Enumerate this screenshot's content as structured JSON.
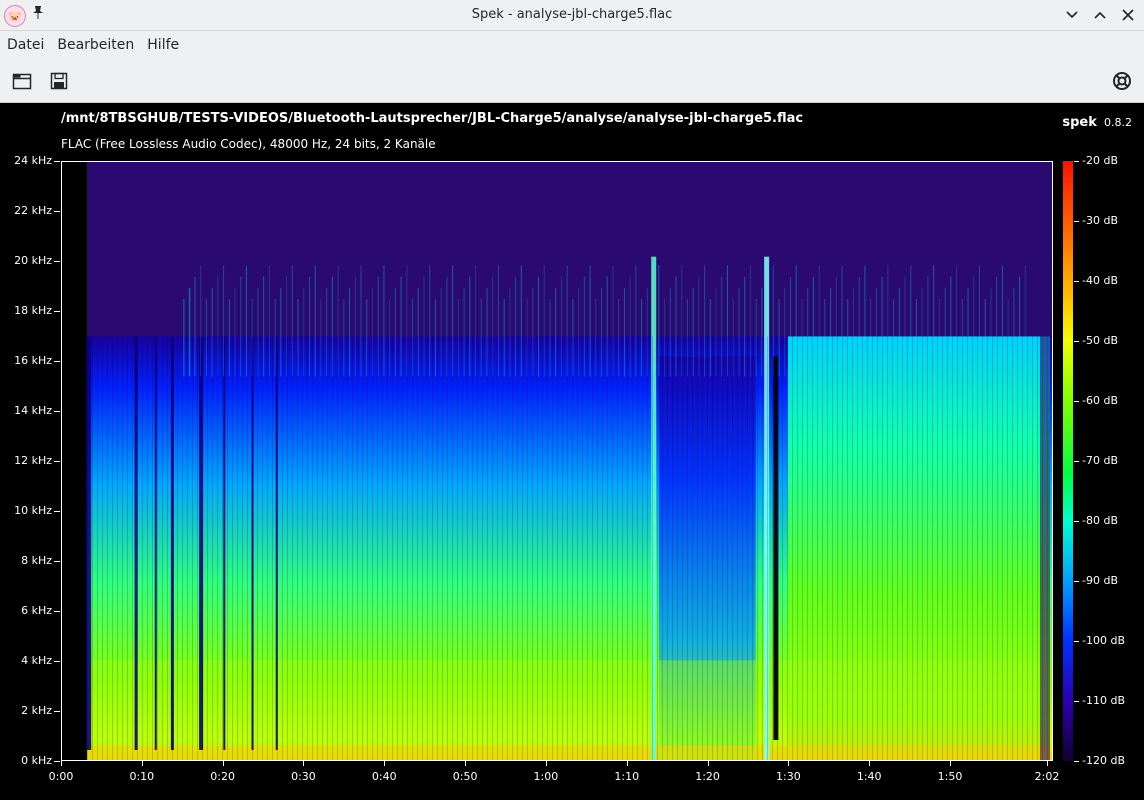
{
  "window": {
    "title": "Spek - analyse-jbl-charge5.flac",
    "controls": [
      "minimize",
      "maximize",
      "close"
    ]
  },
  "menu": {
    "items": [
      "Datei",
      "Bearbeiten",
      "Hilfe"
    ]
  },
  "toolbar": {
    "open_icon": "folder-open-icon",
    "save_icon": "save-icon",
    "help_icon": "lifebuoy-icon"
  },
  "spek": {
    "file_path": "/mnt/8TBSGHUB/TESTS-VIDEOS/Bluetooth-Lautsprecher/JBL-Charge5/analyse/analyse-jbl-charge5.flac",
    "file_info": "FLAC (Free Lossless Audio Codec), 48000 Hz, 24 bits, 2 Kanäle",
    "brand_name": "spek",
    "brand_version": "0.8.2"
  },
  "chart_data": {
    "type": "heatmap",
    "y_ticks": [
      "24 kHz",
      "22 kHz",
      "20 kHz",
      "18 kHz",
      "16 kHz",
      "14 kHz",
      "12 kHz",
      "10 kHz",
      "8 kHz",
      "6 kHz",
      "4 kHz",
      "2 kHz",
      "0 kHz"
    ],
    "x_ticks": [
      "0:00",
      "0:10",
      "0:20",
      "0:30",
      "0:40",
      "0:50",
      "1:00",
      "1:10",
      "1:20",
      "1:30",
      "1:40",
      "1:50",
      "2:02"
    ],
    "db_ticks": [
      "-20 dB",
      "-30 dB",
      "-40 dB",
      "-50 dB",
      "-60 dB",
      "-70 dB",
      "-80 dB",
      "-90 dB",
      "-100 dB",
      "-110 dB",
      "-120 dB"
    ],
    "ylim_khz": [
      0,
      24
    ],
    "xlim_seconds": [
      0,
      122
    ],
    "zlim_db": [
      -120,
      -20
    ],
    "colors": {
      "silent": "#000000",
      "noise_floor": "#2a0a70",
      "low": "#0028ff",
      "mid": "#00e0ff",
      "high": "#7cff00",
      "peak": "#ffd000"
    }
  }
}
